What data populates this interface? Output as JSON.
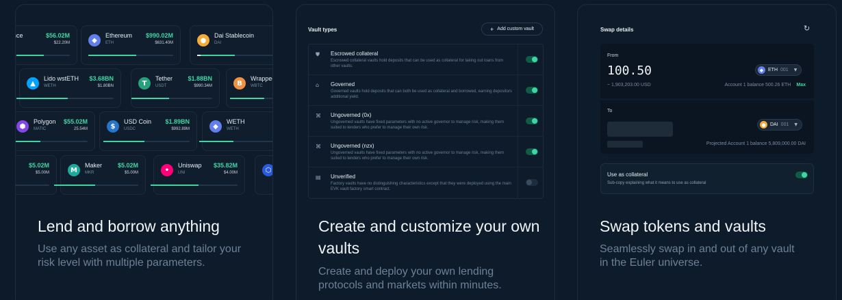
{
  "lend": {
    "title": "Lend and borrow anything",
    "description": "Use any asset as collateral and tailor your risk level with multiple parameters.",
    "tiles": [
      {
        "name": "nce",
        "symbol": "",
        "value": "$56.02M",
        "sub": "$22.20M",
        "icon": "",
        "color": "#000000"
      },
      {
        "name": "Ethereum",
        "symbol": "ETH",
        "value": "$990.02M",
        "sub": "$631.40M",
        "icon": "ethereum-icon",
        "color": "#627eea"
      },
      {
        "name": "Dai Stablecoin",
        "symbol": "DAI",
        "value": "",
        "sub": "",
        "icon": "dai-icon",
        "color": "#f5ac37"
      },
      {
        "name": "Lido wstETH",
        "symbol": "WETH",
        "value": "$3.68BN",
        "sub": "$1.80BN",
        "icon": "lido-icon",
        "color": "#00a3ff"
      },
      {
        "name": "Tether",
        "symbol": "USDT",
        "value": "$1.88BN",
        "sub": "$990.34M",
        "icon": "tether-icon",
        "color": "#26a17b"
      },
      {
        "name": "Wrapped",
        "symbol": "WBTC",
        "value": "",
        "sub": "",
        "icon": "wbtc-icon",
        "color": "#f09242"
      },
      {
        "name": "Polygon",
        "symbol": "MATIC",
        "value": "$55.02M",
        "sub": "25.54M",
        "icon": "polygon-icon",
        "color": "#8247e5"
      },
      {
        "name": "USD Coin",
        "symbol": "USDC",
        "value": "$1.89BN",
        "sub": "$992.89M",
        "icon": "usdc-icon",
        "color": "#2775ca"
      },
      {
        "name": "WETH",
        "symbol": "WETH",
        "value": "$200",
        "sub": "$1",
        "icon": "weth-icon",
        "color": "#627eea"
      },
      {
        "name": "",
        "symbol": "",
        "value": "$5.02M",
        "sub": "$5.00M",
        "icon": "",
        "color": "#000000"
      },
      {
        "name": "Maker",
        "symbol": "MKR",
        "value": "$5.02M",
        "sub": "$5.00M",
        "icon": "maker-icon",
        "color": "#1aab9b"
      },
      {
        "name": "Uniswap",
        "symbol": "UNI",
        "value": "$35.82M",
        "sub": "$4.00M",
        "icon": "uniswap-icon",
        "color": "#ff007a"
      },
      {
        "name": "",
        "symbol": "",
        "value": "",
        "sub": "",
        "icon": "chainlink-icon",
        "color": "#2a5ada"
      }
    ]
  },
  "vaults": {
    "title": "Create and customize your own vaults",
    "description": "Create and deploy your own lending protocols and markets within minutes.",
    "header": "Vault types",
    "add_button": "Add custom vault",
    "types": [
      {
        "title": "Escrowed collateral",
        "desc": "Escrowed collateral vaults hold deposits that can be used as collateral for taking out loans from other vaults.",
        "icon": "shield-icon",
        "enabled": true
      },
      {
        "title": "Governed",
        "desc": "Governed vaults hold deposits that can both be used as collateral and borrowed, earning depositors additional yield.",
        "icon": "bank-icon",
        "enabled": true
      },
      {
        "title": "Ungoverned (0x)",
        "desc": "Ungoverned vaults have fixed parameters with no active governor to manage risk, making them suited to lenders who prefer to manage their own risk.",
        "icon": "ungoverned-icon",
        "enabled": true
      },
      {
        "title": "Ungoverned (nzx)",
        "desc": "Ungoverned vaults have fixed parameters with no active governor to manage risk, making them suited to lenders who prefer to manage their own risk.",
        "icon": "ungoverned-icon",
        "enabled": true
      },
      {
        "title": "Unverified",
        "desc": "Factory vaults have no distinguishing characteristics except that they were deployed using the main EVK vault factory smart contract.",
        "icon": "factory-icon",
        "enabled": false
      }
    ]
  },
  "swap": {
    "title": "Swap tokens and vaults",
    "description": "Seamlessly swap in and out of any vault in the Euler universe.",
    "header": "Swap details",
    "from_label": "From",
    "from_amount": "100.50",
    "from_token": "ETH",
    "from_token_num": "001",
    "from_usd": "~ 1,903,203.00 USD",
    "from_balance": "Account 1 balance 500.26 ETH",
    "max_label": "Max",
    "to_label": "To",
    "to_token": "DAI",
    "to_token_num": "001",
    "to_balance": "Projected Account 1 balance 5,809,000.00 DAI",
    "collateral_title": "Use as collateral",
    "collateral_sub": "Sub-copy explaining what it means to use as collateral",
    "collateral_enabled": true
  }
}
